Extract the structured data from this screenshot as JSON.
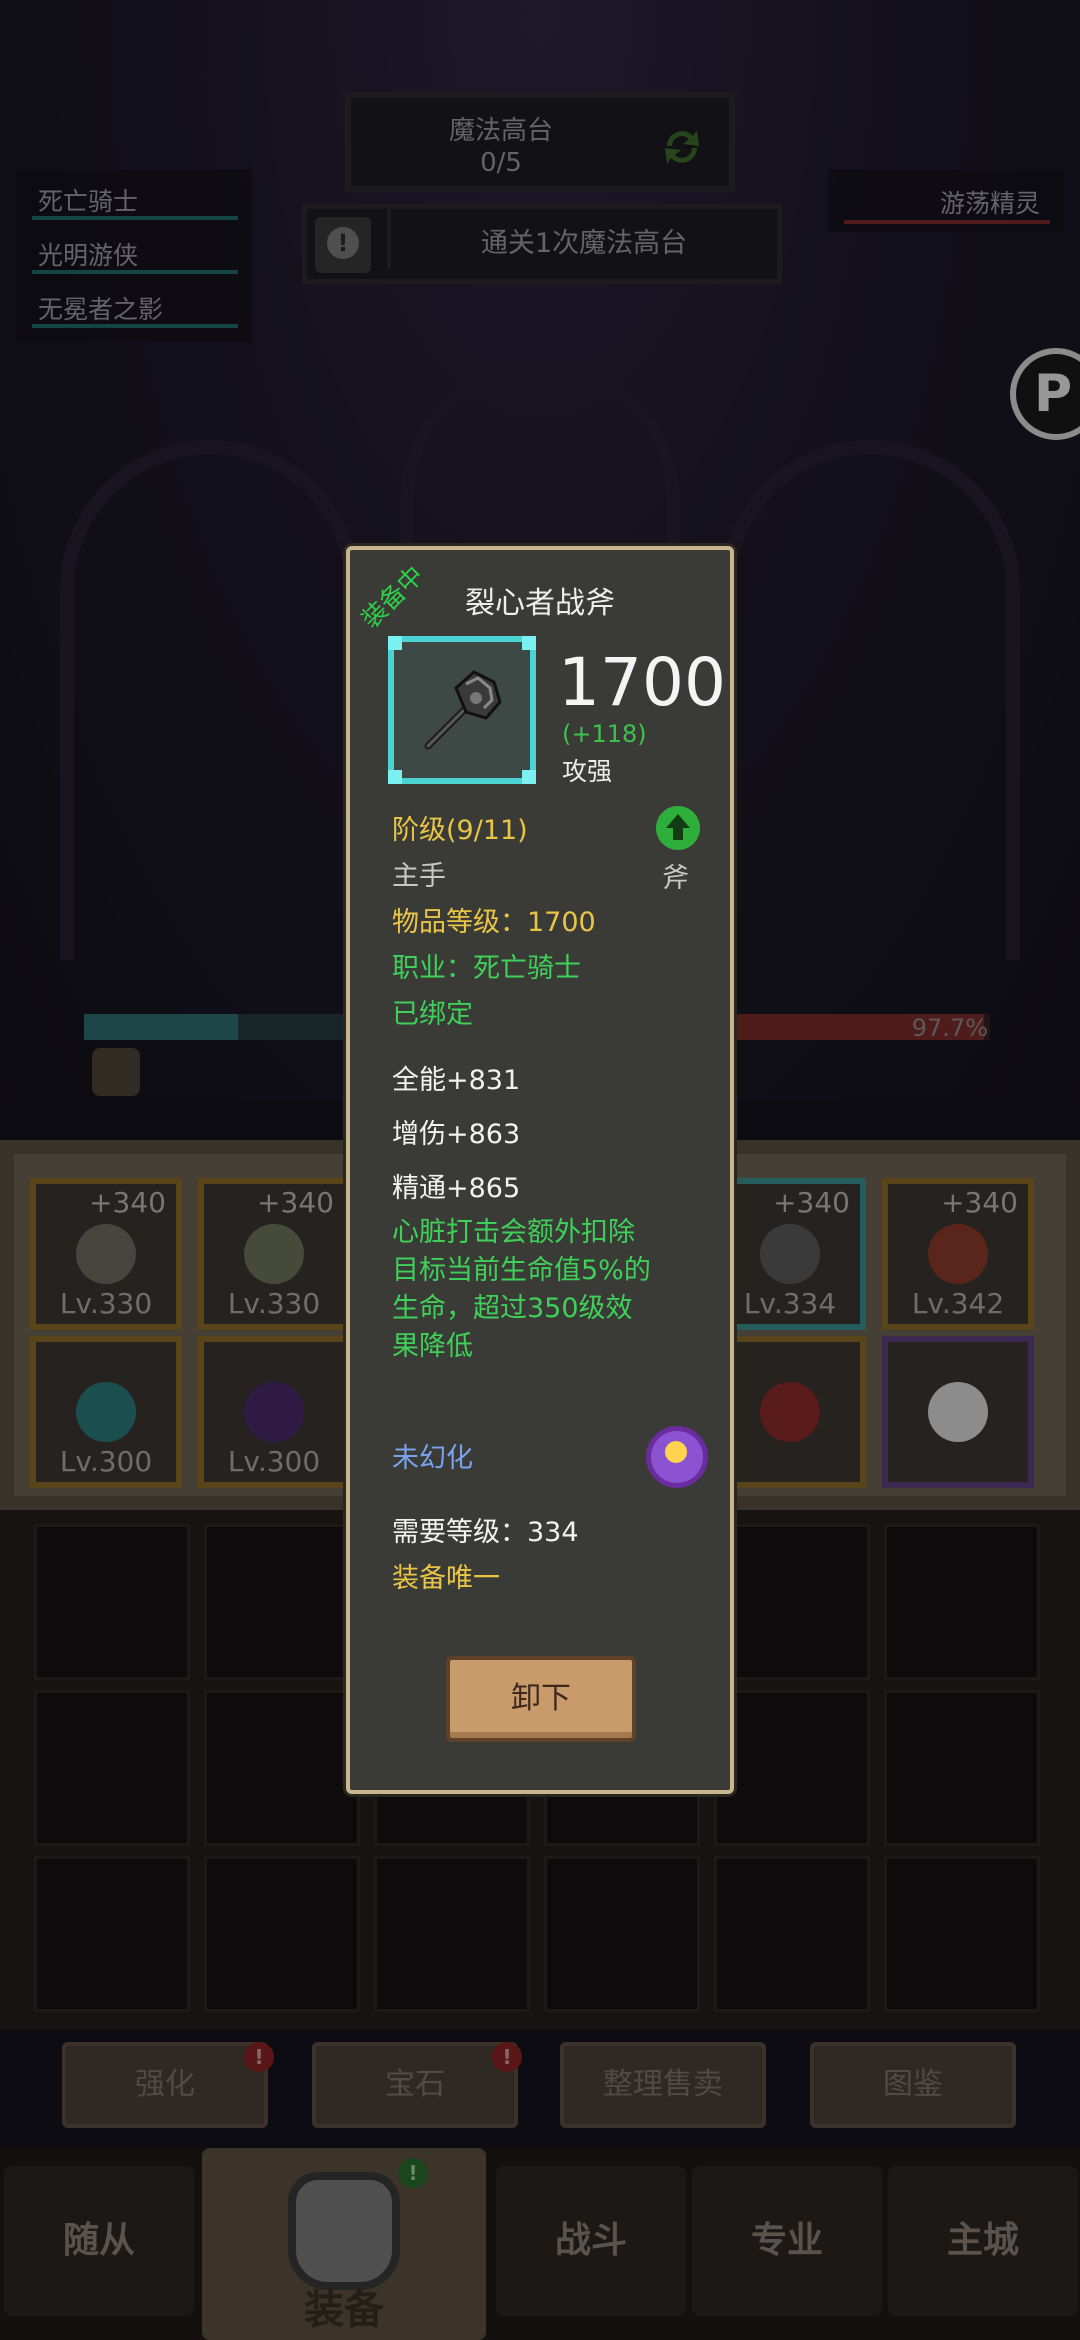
{
  "quest": {
    "title": "魔法高台",
    "progress": "0/5",
    "task": "通关1次魔法高台"
  },
  "party": [
    "死亡骑士",
    "光明游侠",
    "无冕者之影"
  ],
  "enemy": "游荡精灵",
  "battle": {
    "enemy_hp_percent": "97.7%",
    "player_hp_fraction": 0.55,
    "enemy_hp_fraction": 0.977
  },
  "equipment_slots": [
    {
      "plus": "+340",
      "lv": "Lv.330",
      "border": "gold"
    },
    {
      "plus": "+340",
      "lv": "Lv.330",
      "border": "gold"
    },
    {
      "plus": "+340",
      "lv": "Lv.334",
      "border": "teal"
    },
    {
      "plus": "+340",
      "lv": "Lv.342",
      "border": "gold"
    },
    {
      "plus": "",
      "lv": "Lv.300",
      "border": "gold"
    },
    {
      "plus": "",
      "lv": "Lv.300",
      "border": "gold"
    },
    {
      "plus": "",
      "lv": "",
      "border": "gold"
    },
    {
      "plus": "",
      "lv": "",
      "border": "purple"
    }
  ],
  "actions": {
    "enhance": "强化",
    "gem": "宝石",
    "sort_sell": "整理售卖",
    "codex": "图鉴"
  },
  "nav": {
    "followers": "随从",
    "equipment": "装备",
    "battle": "战斗",
    "profession": "专业",
    "main_city": "主城"
  },
  "item": {
    "equipped_tag": "装备中",
    "name": "裂心者战斧",
    "score": "1700",
    "score_delta": "(+118)",
    "stat_name": "攻强",
    "tier": "阶级(9/11)",
    "slot": "主手",
    "weapon_type": "斧",
    "item_level": "物品等级：1700",
    "class_req": "职业：死亡骑士",
    "bound": "已绑定",
    "stats": [
      "全能+831",
      "增伤+863",
      "精通+865"
    ],
    "effect": "心脏打击会额外扣除目标当前生命值5%的生命，超过350级效果降低",
    "illusion": "未幻化",
    "required_level": "需要等级：334",
    "unique": "装备唯一",
    "unequip_button": "卸下"
  },
  "colors": {
    "popup_border": "#c9b58f",
    "green": "#3fd05a",
    "yellow": "#e9c547",
    "teal": "#4ad3d3"
  }
}
